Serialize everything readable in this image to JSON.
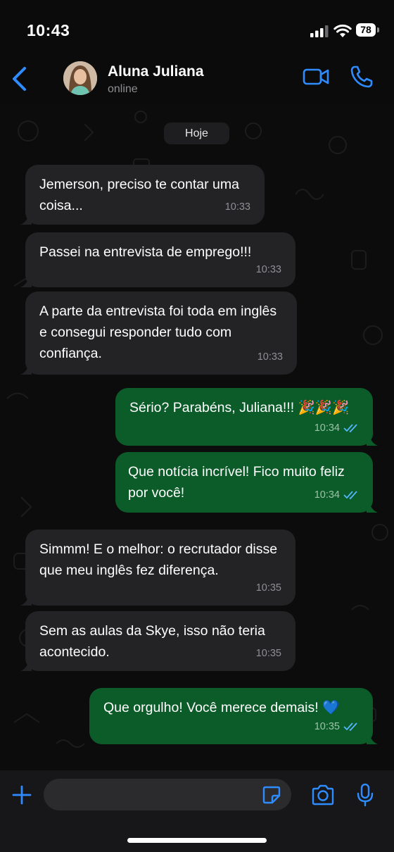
{
  "status_bar": {
    "time": "10:43",
    "battery": "78"
  },
  "header": {
    "contact_name": "Aluna Juliana",
    "contact_status": "online"
  },
  "chat": {
    "date_chip": "Hoje",
    "messages": [
      {
        "direction": "incoming",
        "text": "Jemerson, preciso te contar uma coisa...",
        "time": "10:33"
      },
      {
        "direction": "incoming",
        "text": "Passei na entrevista de emprego!!!",
        "time": "10:33"
      },
      {
        "direction": "incoming",
        "text": "A parte da entrevista foi toda em inglês e consegui responder tudo com confiança.",
        "time": "10:33"
      },
      {
        "direction": "outgoing",
        "text": "Sério? Parabéns, Juliana!!! 🎉🎉🎉",
        "time": "10:34",
        "read": true
      },
      {
        "direction": "outgoing",
        "text": "Que notícia incrível! Fico muito feliz por você!",
        "time": "10:34",
        "read": true
      },
      {
        "direction": "incoming",
        "text": "Simmm! E o melhor: o recrutador disse que meu inglês fez diferença.",
        "time": "10:35"
      },
      {
        "direction": "incoming",
        "text": "Sem as aulas da Skye, isso não teria acontecido.",
        "time": "10:35"
      },
      {
        "direction": "outgoing",
        "text": "Que orgulho! Você merece demais! 💙",
        "time": "10:35",
        "read": true
      }
    ]
  },
  "input_bar": {
    "message_value": "",
    "message_placeholder": ""
  },
  "colors": {
    "accent": "#2f8cff",
    "outgoing_bubble": "#0c5c2a",
    "incoming_bubble": "#232325",
    "read_tick": "#53b6ff"
  },
  "icons": [
    "back-chevron-icon",
    "video-camera-icon",
    "phone-icon",
    "plus-icon",
    "sticker-icon",
    "camera-icon",
    "microphone-icon",
    "double-check-icon"
  ]
}
